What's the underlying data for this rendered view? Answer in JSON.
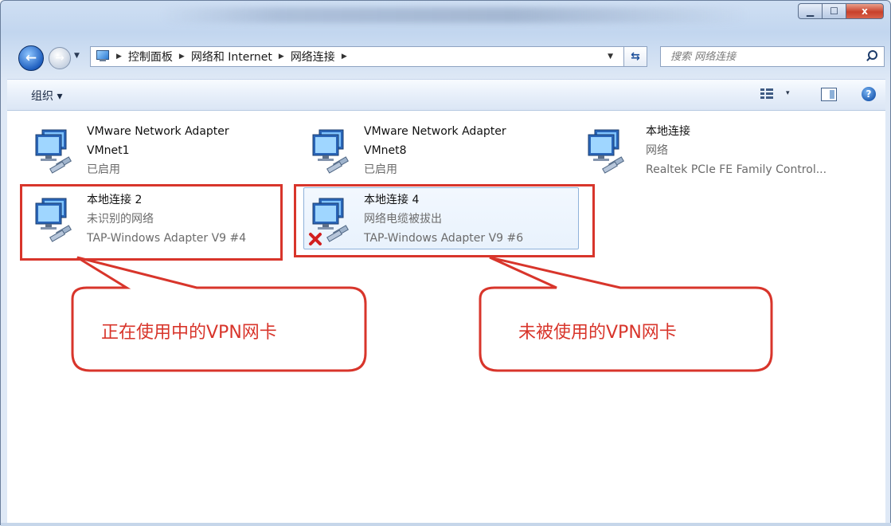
{
  "window": {
    "controls": {
      "minimize": "▁",
      "maximize": "☐",
      "close": "x"
    }
  },
  "address": {
    "crumbs": [
      "控制面板",
      "网络和 Internet",
      "网络连接"
    ],
    "search_placeholder": "搜索 网络连接"
  },
  "toolbar": {
    "organize_label": "组织 ▾",
    "view_dropdown": "▾",
    "help": "?"
  },
  "connections": [
    {
      "name": "VMware Network Adapter",
      "name2": "VMnet1",
      "status": "已启用",
      "adapter": "",
      "disconnected": false
    },
    {
      "name": "VMware Network Adapter",
      "name2": "VMnet8",
      "status": "已启用",
      "adapter": "",
      "disconnected": false
    },
    {
      "name": "本地连接",
      "name2": "",
      "status": "网络",
      "adapter": "Realtek PCIe FE Family Control...",
      "disconnected": false
    },
    {
      "name": "本地连接 2",
      "name2": "",
      "status": "未识别的网络",
      "adapter": "TAP-Windows Adapter V9 #4",
      "disconnected": false
    },
    {
      "name": "本地连接 4",
      "name2": "",
      "status": "网络电缆被拔出",
      "adapter": "TAP-Windows Adapter V9 #6",
      "disconnected": true
    }
  ],
  "annotations": {
    "callout_left": "正在使用中的VPN网卡",
    "callout_right": "未被使用的VPN网卡",
    "color": "#d8352b"
  }
}
